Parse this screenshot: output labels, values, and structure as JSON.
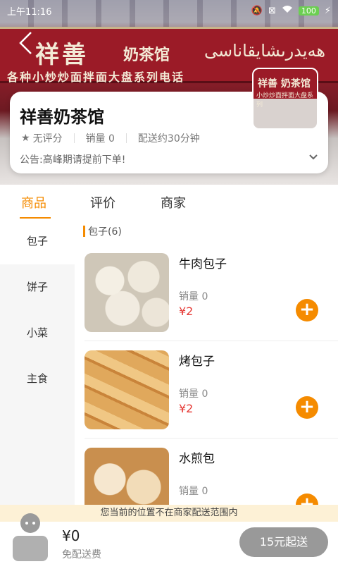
{
  "status_bar": {
    "time": "上午11:16",
    "battery": "100"
  },
  "banner": {
    "sign_main": "祥善",
    "sign_sub": "奶茶馆",
    "sign_line2": "各种小炒炒面拌面大盘系列电话",
    "sign_uyghur": "ھەيدرىشايقاناسى"
  },
  "shop": {
    "name": "祥善奶茶馆",
    "rating": "无评分",
    "sales": "销量 0",
    "delivery": "配送约30分钟",
    "notice": "公告:高峰期请提前下单!",
    "thumb_text": "祥善 奶茶馆",
    "thumb_sub": "小炒炒面拌面大盘系列"
  },
  "tabs": [
    "商品",
    "评价",
    "商家"
  ],
  "categories": [
    "包子",
    "饼子",
    "小菜",
    "主食"
  ],
  "section_title": "包子(6)",
  "products": [
    {
      "name": "牛肉包子",
      "sales": "销量 0",
      "price": "¥2"
    },
    {
      "name": "烤包子",
      "sales": "销量 0",
      "price": "¥2"
    },
    {
      "name": "水煎包",
      "sales": "销量 0",
      "price": ""
    }
  ],
  "bottom": {
    "warning": "您当前的位置不在商家配送范围内",
    "total": "¥0",
    "fee": "免配送费",
    "checkout": "15元起送"
  },
  "colors": {
    "accent": "#f58b00",
    "price": "#e53935"
  }
}
